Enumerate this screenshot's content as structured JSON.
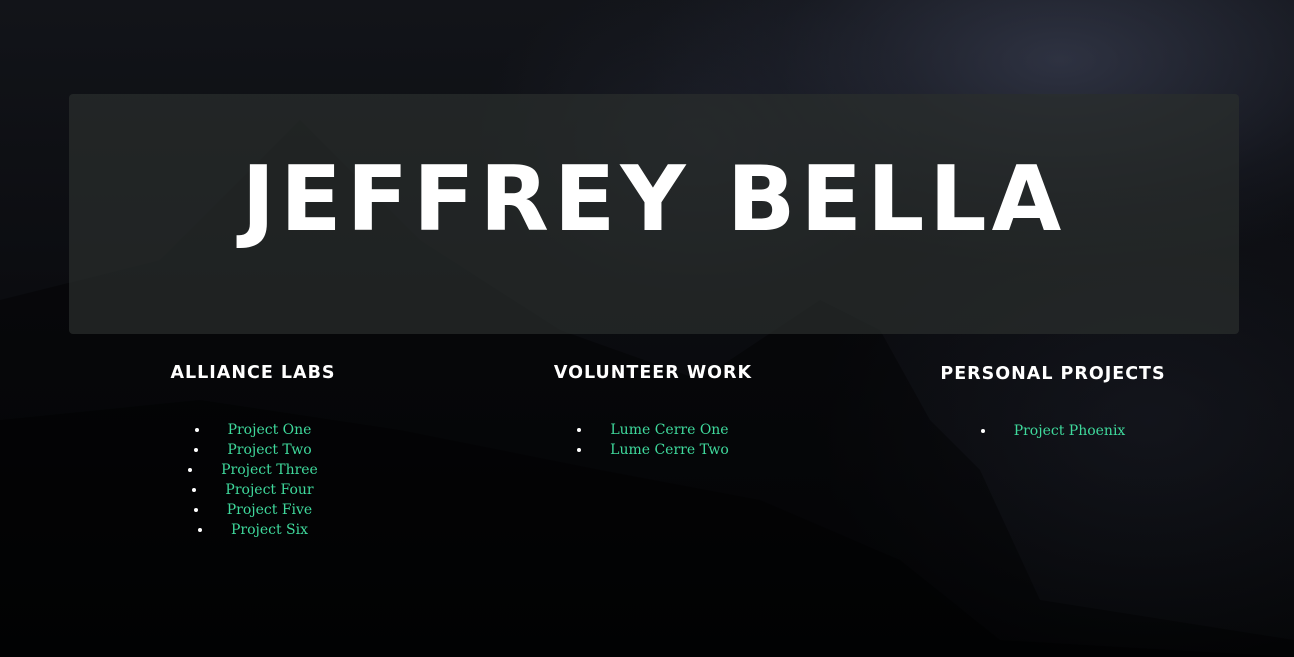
{
  "colors": {
    "accent_link": "#3fd99c",
    "heading_text": "#ffffff",
    "hero_panel": "#2a2e2d",
    "background": "#07080a"
  },
  "hero": {
    "title": "JEFFREY BELLA"
  },
  "sections": [
    {
      "heading": "ALLIANCE LABS",
      "items": [
        "Project One",
        "Project Two",
        "Project Three",
        "Project Four",
        "Project Five",
        "Project Six"
      ]
    },
    {
      "heading": "VOLUNTEER WORK",
      "items": [
        "Lume Cerre One",
        "Lume Cerre Two"
      ]
    },
    {
      "heading": "PERSONAL PROJECTS",
      "items": [
        "Project Phoenix"
      ]
    }
  ]
}
